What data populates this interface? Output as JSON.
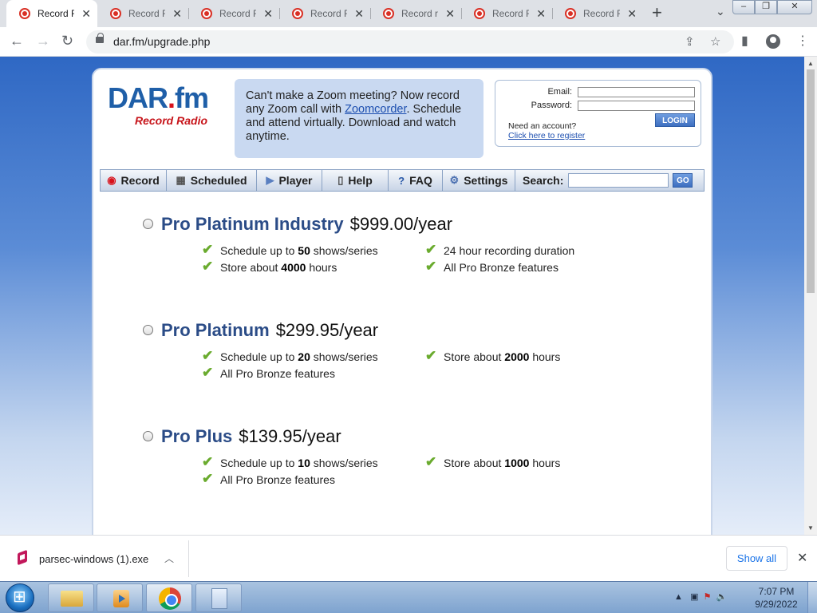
{
  "browser": {
    "tabs": [
      {
        "label": "Record R"
      },
      {
        "label": "Record R"
      },
      {
        "label": "Record R"
      },
      {
        "label": "Record R"
      },
      {
        "label": "Record ra"
      },
      {
        "label": "Record R"
      },
      {
        "label": "Record R"
      }
    ],
    "url": "dar.fm/upgrade.php"
  },
  "site": {
    "logo": {
      "brand": "DAR",
      "dot": ".",
      "tld": "fm",
      "tagline": "Record Radio"
    },
    "promo": {
      "text_before": "Can't make a Zoom meeting? Now record any Zoom call with ",
      "link": "Zoomcorder",
      "text_after": ". Schedule and attend virtually. Download and watch anytime."
    },
    "login": {
      "email_label": "Email:",
      "password_label": "Password:",
      "button": "LOGIN",
      "need_account": "Need an account?",
      "register_link": "Click here to register"
    },
    "menu": [
      {
        "label": "Record",
        "icon": "record-icon"
      },
      {
        "label": "Scheduled",
        "icon": "calendar-icon"
      },
      {
        "label": "Player",
        "icon": "play-icon"
      },
      {
        "label": "Help",
        "icon": "phone-icon"
      },
      {
        "label": "FAQ",
        "icon": "question-icon"
      },
      {
        "label": "Settings",
        "icon": "gear-icon"
      }
    ],
    "search": {
      "label": "Search:",
      "button": "GO"
    },
    "plans": [
      {
        "name": "Pro Platinum Industry",
        "price": "$999.00/year",
        "features": [
          {
            "pre": "Schedule up to ",
            "bold": "50",
            "post": " shows/series"
          },
          {
            "pre": "24 hour recording duration",
            "bold": "",
            "post": ""
          },
          {
            "pre": "Store about ",
            "bold": "4000",
            "post": " hours"
          },
          {
            "pre": "All Pro Bronze features",
            "bold": "",
            "post": ""
          }
        ]
      },
      {
        "name": "Pro Platinum",
        "price": "$299.95/year",
        "features": [
          {
            "pre": "Schedule up to ",
            "bold": "20",
            "post": " shows/series"
          },
          {
            "pre": "Store about ",
            "bold": "2000",
            "post": " hours"
          },
          {
            "pre": "All Pro Bronze features",
            "bold": "",
            "post": ""
          }
        ]
      },
      {
        "name": "Pro Plus",
        "price": "$139.95/year",
        "features": [
          {
            "pre": "Schedule up to ",
            "bold": "10",
            "post": " shows/series"
          },
          {
            "pre": "Store about ",
            "bold": "1000",
            "post": " hours"
          },
          {
            "pre": "All Pro Bronze features",
            "bold": "",
            "post": ""
          }
        ]
      }
    ]
  },
  "downloads": {
    "file": "parsec-windows (1).exe",
    "show_all": "Show all"
  },
  "taskbar": {
    "time": "7:07 PM",
    "date": "9/29/2022"
  }
}
